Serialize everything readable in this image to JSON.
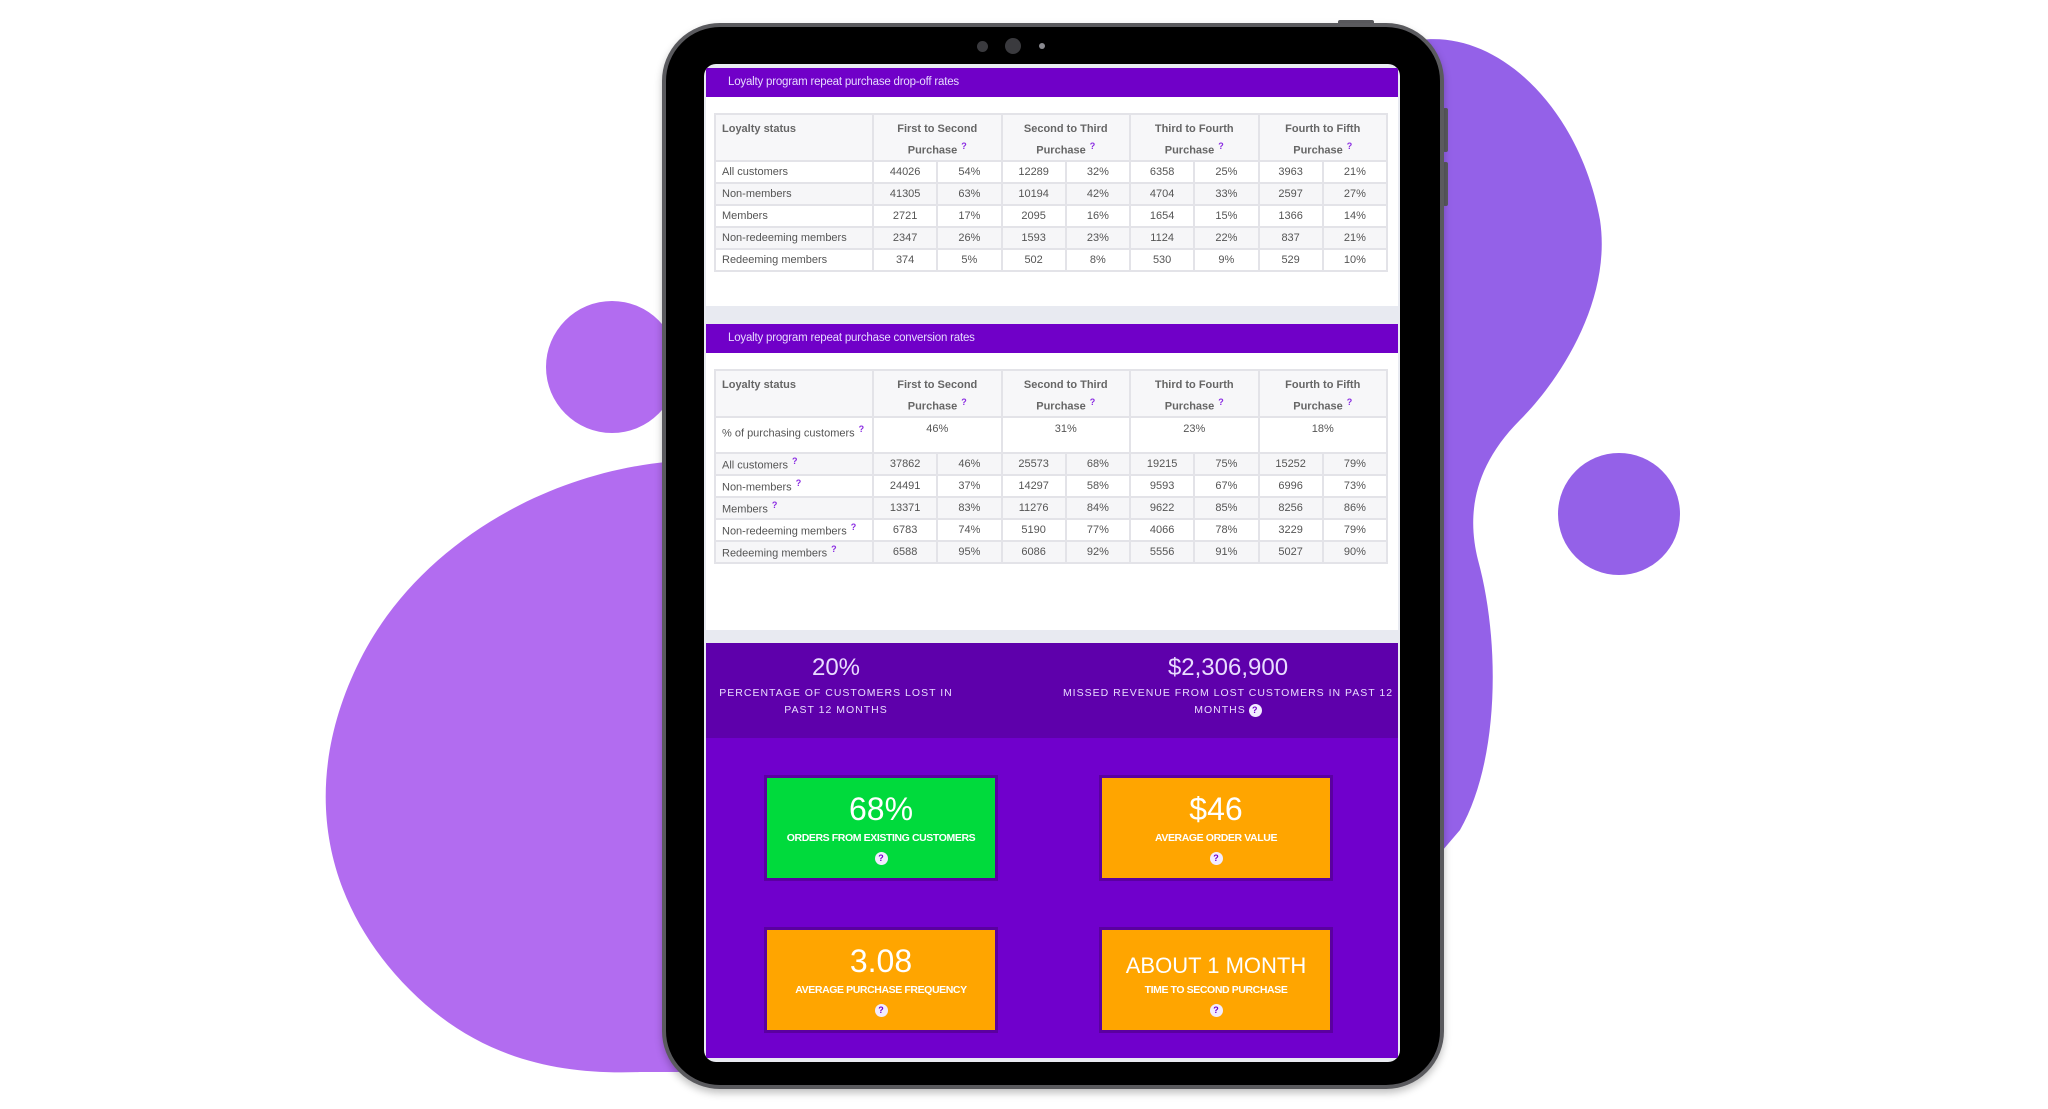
{
  "colors": {
    "blob_left": "#b26cf0",
    "blob_right": "#9461e8",
    "header_bar": "#7000c8",
    "kpi_top": "#5e00ab",
    "kpi_bottom": "#7000cc",
    "card_green": "#00da3c",
    "card_orange": "#ffa500"
  },
  "dropoff": {
    "title": "Loyalty program repeat purchase drop-off rates",
    "header_label": "Loyalty status",
    "columns": [
      "First to Second Purchase",
      "Second to Third Purchase",
      "Third to Fourth Purchase",
      "Fourth to Fifth Purchase"
    ],
    "rows": [
      {
        "label": "All customers",
        "cells": [
          "44026",
          "54%",
          "12289",
          "32%",
          "6358",
          "25%",
          "3963",
          "21%"
        ]
      },
      {
        "label": "Non-members",
        "cells": [
          "41305",
          "63%",
          "10194",
          "42%",
          "4704",
          "33%",
          "2597",
          "27%"
        ]
      },
      {
        "label": "Members",
        "cells": [
          "2721",
          "17%",
          "2095",
          "16%",
          "1654",
          "15%",
          "1366",
          "14%"
        ]
      },
      {
        "label": "Non-redeeming members",
        "cells": [
          "2347",
          "26%",
          "1593",
          "23%",
          "1124",
          "22%",
          "837",
          "21%"
        ]
      },
      {
        "label": "Redeeming members",
        "cells": [
          "374",
          "5%",
          "502",
          "8%",
          "530",
          "9%",
          "529",
          "10%"
        ]
      }
    ]
  },
  "conversion": {
    "title": "Loyalty program repeat purchase conversion rates",
    "header_label": "Loyalty status",
    "columns": [
      "First to Second Purchase",
      "Second to Third Purchase",
      "Third to Fourth Purchase",
      "Fourth to Fifth Purchase"
    ],
    "pct_row": {
      "label": "% of purchasing customers",
      "values": [
        "46%",
        "31%",
        "23%",
        "18%"
      ]
    },
    "rows": [
      {
        "label": "All customers",
        "cells": [
          "37862",
          "46%",
          "25573",
          "68%",
          "19215",
          "75%",
          "15252",
          "79%"
        ]
      },
      {
        "label": "Non-members",
        "cells": [
          "24491",
          "37%",
          "14297",
          "58%",
          "9593",
          "67%",
          "6996",
          "73%"
        ]
      },
      {
        "label": "Members",
        "cells": [
          "13371",
          "83%",
          "11276",
          "84%",
          "9622",
          "85%",
          "8256",
          "86%"
        ]
      },
      {
        "label": "Non-redeeming members",
        "cells": [
          "6783",
          "74%",
          "5190",
          "77%",
          "4066",
          "78%",
          "3229",
          "79%"
        ]
      },
      {
        "label": "Redeeming members",
        "cells": [
          "6588",
          "95%",
          "6086",
          "92%",
          "5556",
          "91%",
          "5027",
          "90%"
        ]
      }
    ]
  },
  "kpis": {
    "lost_pct": {
      "value": "20%",
      "label": "PERCENTAGE OF CUSTOMERS LOST IN PAST 12 MONTHS"
    },
    "missed_revenue": {
      "value": "$2,306,900",
      "label": "MISSED REVENUE FROM LOST CUSTOMERS IN PAST 12 MONTHS"
    },
    "cards": [
      {
        "value": "68%",
        "label": "ORDERS FROM EXISTING CUSTOMERS"
      },
      {
        "value": "$46",
        "label": "AVERAGE ORDER VALUE"
      },
      {
        "value": "3.08",
        "label": "AVERAGE PURCHASE FREQUENCY"
      },
      {
        "value": "ABOUT 1 MONTH",
        "label": "TIME TO SECOND PURCHASE"
      }
    ]
  },
  "help_glyph": "?"
}
